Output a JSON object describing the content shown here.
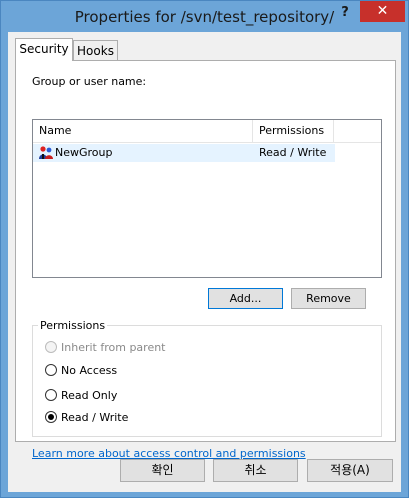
{
  "window": {
    "title": "Properties for /svn/test_repository/",
    "help": "?",
    "close": "✕"
  },
  "tabs": [
    {
      "label": "Security"
    },
    {
      "label": "Hooks"
    }
  ],
  "security": {
    "group_label": "Group or user name:",
    "columns": {
      "name": "Name",
      "permissions": "Permissions"
    },
    "rows": [
      {
        "name": "NewGroup",
        "permissions": "Read / Write",
        "icon": "group-icon"
      }
    ],
    "add_button": "Add...",
    "remove_button": "Remove",
    "permissions_title": "Permissions",
    "options": {
      "inherit": "Inherit from parent",
      "no_access": "No Access",
      "read_only": "Read Only",
      "read_write": "Read / Write"
    },
    "selected_option": "Read / Write",
    "learn_more": "Learn more about access control and permissions"
  },
  "footer": {
    "ok": "확인",
    "cancel": "취소",
    "apply": "적용(A)"
  }
}
